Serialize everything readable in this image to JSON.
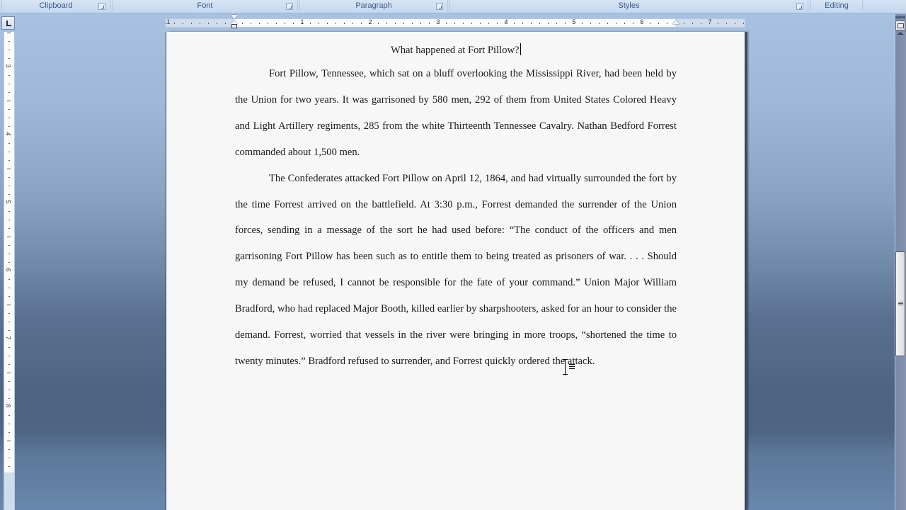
{
  "ribbon": {
    "groups": [
      {
        "label": "Clipboard",
        "has_launcher": true
      },
      {
        "label": "Font",
        "has_launcher": true
      },
      {
        "label": "Paragraph",
        "has_launcher": true
      },
      {
        "label": "Styles",
        "has_launcher": true
      },
      {
        "label": "Editing",
        "has_launcher": false
      }
    ]
  },
  "ruler": {
    "horizontal_numbers": [
      "1",
      "1",
      "2",
      "3",
      "4",
      "5",
      "6",
      "7"
    ],
    "vertical_numbers": [
      "3",
      "4",
      "5",
      "6",
      "7",
      "8"
    ],
    "units": "inches"
  },
  "document": {
    "title": "What happened at Fort Pillow?",
    "paragraphs": [
      "Fort Pillow, Tennessee, which sat on a bluff overlooking the Mississippi River, had been held by the Union for two years. It was garrisoned by 580 men, 292 of them from United States Colored Heavy and Light Artillery regiments, 285 from the white Thirteenth Tennessee Cavalry. Nathan Bedford Forrest commanded about 1,500 men.",
      "The Confederates attacked Fort Pillow on April 12, 1864, and had virtually surrounded the fort by the time Forrest arrived on the battlefield. At 3:30 p.m., Forrest demanded the surrender of the Union forces, sending in a message of the sort he had used before: “The conduct of the officers and men garrisoning Fort Pillow has been such as to entitle them to being treated as prisoners of war. . . . Should my demand be refused, I cannot be responsible for the fate of your command.” Union Major William Bradford, who had replaced Major Booth, killed earlier by sharpshooters, asked for an hour to consider the demand. Forrest, worried that vessels in the river were bringing in more troops, “shortened the time to twenty minutes.” Bradford refused to surrender, and Forrest quickly ordered the attack."
    ]
  },
  "icons": {
    "tab_selector": "left-tab-stop-icon",
    "view_ruler": "view-ruler-icon",
    "cursor": "i-beam-cursor-icon"
  },
  "scrollbar": {
    "position_fraction": 0.52
  }
}
